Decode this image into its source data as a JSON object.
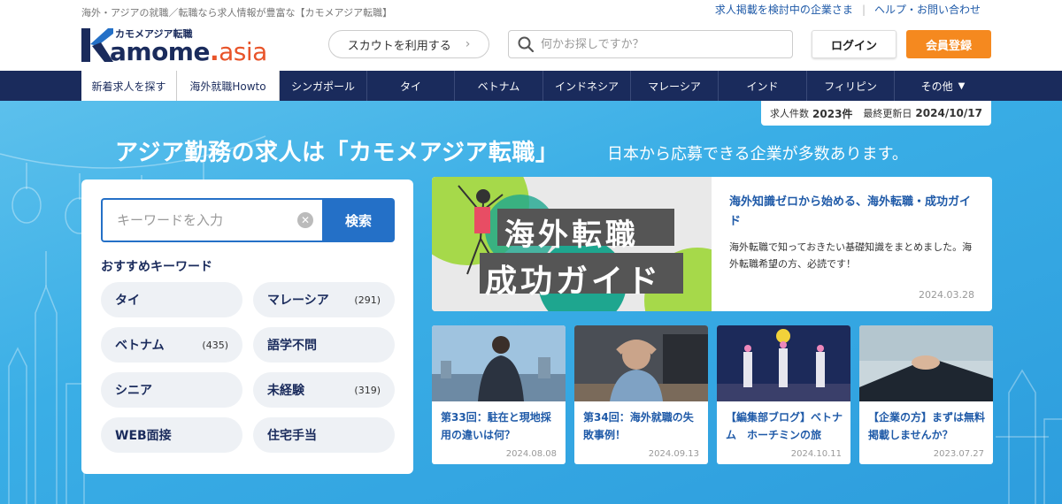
{
  "header": {
    "tagline": "海外・アジアの就職／転職なら求人情報が豊富な【カモメアジア転職】",
    "top_links": [
      "求人掲載を検討中の企業さま",
      "ヘルプ・お問い合わせ"
    ],
    "logo": {
      "sub": "カモメアジア転職",
      "main_a": "amome",
      "main_dot": ".",
      "main_b": "asia"
    },
    "scout_label": "スカウトを利用する",
    "search_placeholder": "何かお探しですか？",
    "login_label": "ログイン",
    "register_label": "会員登録"
  },
  "nav": {
    "items": [
      {
        "label": "新着求人を探す"
      },
      {
        "label": "海外就職Howto"
      },
      {
        "label": "シンガポール"
      },
      {
        "label": "タイ"
      },
      {
        "label": "ベトナム"
      },
      {
        "label": "インドネシア"
      },
      {
        "label": "マレーシア"
      },
      {
        "label": "インド"
      },
      {
        "label": "フィリピン"
      },
      {
        "label": "その他"
      }
    ]
  },
  "stats": {
    "count_label": "求人件数",
    "count_value": "2023件",
    "updated_label": "最終更新日",
    "updated_value": "2024/10/17"
  },
  "hero": {
    "title": "アジア勤務の求人は「カモメアジア転職」",
    "subtitle": "日本から応募できる企業が多数あります。"
  },
  "search": {
    "placeholder": "キーワードを入力",
    "button_label": "検索",
    "recommended_title": "おすすめキーワード",
    "keywords": [
      {
        "label": "タイ",
        "count": ""
      },
      {
        "label": "マレーシア",
        "count": "(291)"
      },
      {
        "label": "ベトナム",
        "count": "(435)"
      },
      {
        "label": "語学不問",
        "count": ""
      },
      {
        "label": "シニア",
        "count": ""
      },
      {
        "label": "未経験",
        "count": "(319)"
      },
      {
        "label": "WEB面接",
        "count": ""
      },
      {
        "label": "住宅手当",
        "count": ""
      }
    ]
  },
  "feature": {
    "image_text_1": "海外転職",
    "image_text_2": "成功ガイド",
    "title": "海外知識ゼロから始める、海外転職・成功ガイド",
    "desc": "海外転職で知っておきたい基礎知識をまとめました。海外転職希望の方、必読です！",
    "date": "2024.03.28"
  },
  "cards": [
    {
      "title": "第33回：駐在と現地採用の違いは何？",
      "date": "2024.08.08"
    },
    {
      "title": "第34回：海外就職の失敗事例！",
      "date": "2024.09.13"
    },
    {
      "title": "【編集部ブログ】ベトナム　ホーチミンの旅",
      "date": "2024.10.11"
    },
    {
      "title": "【企業の方】まずは無料掲載しませんか？",
      "date": "2023.07.27"
    }
  ],
  "colors": {
    "navy": "#1a2b5c",
    "blue": "#2470c7",
    "orange": "#f5891f",
    "hero_bg": "#3aaee6"
  }
}
